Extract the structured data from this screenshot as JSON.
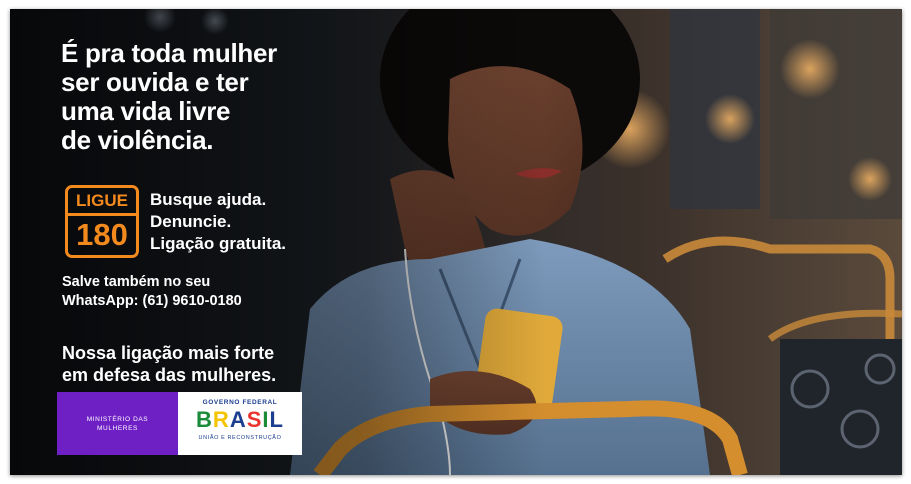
{
  "headline": {
    "lines": [
      "É pra toda mulher",
      "ser ouvida e ter",
      "uma vida livre",
      "de violência."
    ]
  },
  "ligue_badge": {
    "top": "LIGUE",
    "number": "180"
  },
  "actions": [
    "Busque ajuda.",
    "Denuncie.",
    "Ligação gratuita."
  ],
  "whatsapp": {
    "lines": [
      "Salve também no seu",
      "WhatsApp: (61) 9610-0180"
    ]
  },
  "tagline": {
    "lines": [
      "Nossa ligação mais forte",
      "em defesa das mulheres."
    ]
  },
  "logos": {
    "ministerio": {
      "line1": "MINISTÉRIO DAS",
      "line2": "MULHERES"
    },
    "governo": {
      "top": "GOVERNO FEDERAL",
      "brand": "BRASIL",
      "bottom": "UNIÃO E RECONSTRUÇÃO"
    }
  },
  "colors": {
    "accent_orange": "#f38a1e",
    "ministerio_purple": "#6f20c5",
    "text_white": "#ffffff",
    "brasil_letters": [
      "#1b8b3a",
      "#f5c400",
      "#1b3e8f",
      "#e8352e",
      "#1b8b3a",
      "#1b3e8f"
    ]
  }
}
